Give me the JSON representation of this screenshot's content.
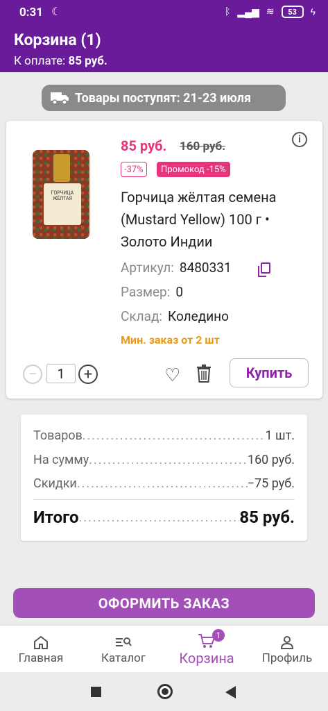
{
  "status": {
    "time": "0:31",
    "battery": "53"
  },
  "header": {
    "title": "Корзина (1)",
    "pay_label": "К оплате:",
    "pay_value": "85 руб."
  },
  "delivery": {
    "text": "Товары поступят: 21-23 июля"
  },
  "product": {
    "price": "85 руб.",
    "old_price": "160 руб.",
    "discount": "-37%",
    "promo": "Промокод -15%",
    "name": "Горчица жёлтая семена (Mustard Yellow) 100 г • Золото Индии",
    "image_label": "ГОРЧИЦА ЖЁЛТАЯ",
    "article_label": "Артикул:",
    "article_value": "8480331",
    "size_label": "Размер:",
    "size_value": "0",
    "warehouse_label": "Склад:",
    "warehouse_value": "Коледино",
    "min_order": "Мин. заказ от 2 шт",
    "quantity": "1",
    "buy_label": "Купить"
  },
  "summary": {
    "items_label": "Товаров",
    "items_value": "1 шт.",
    "sum_label": "На сумму",
    "sum_value": "160 руб.",
    "discount_label": "Скидки",
    "discount_value": "−75 руб.",
    "total_label": "Итого",
    "total_value": "85 руб."
  },
  "checkout": {
    "label": "ОФОРМИТЬ ЗАКАЗ"
  },
  "nav": {
    "items": [
      {
        "label": "Главная",
        "icon": "home-icon"
      },
      {
        "label": "Каталог",
        "icon": "catalog-search-icon"
      },
      {
        "label": "Корзина",
        "icon": "cart-icon",
        "badge": "1"
      },
      {
        "label": "Профиль",
        "icon": "profile-icon"
      }
    ]
  },
  "colors": {
    "brand": "#6a1b9a",
    "accent": "#a24fb8",
    "sale": "#e6357a",
    "warning": "#e89a1a"
  }
}
